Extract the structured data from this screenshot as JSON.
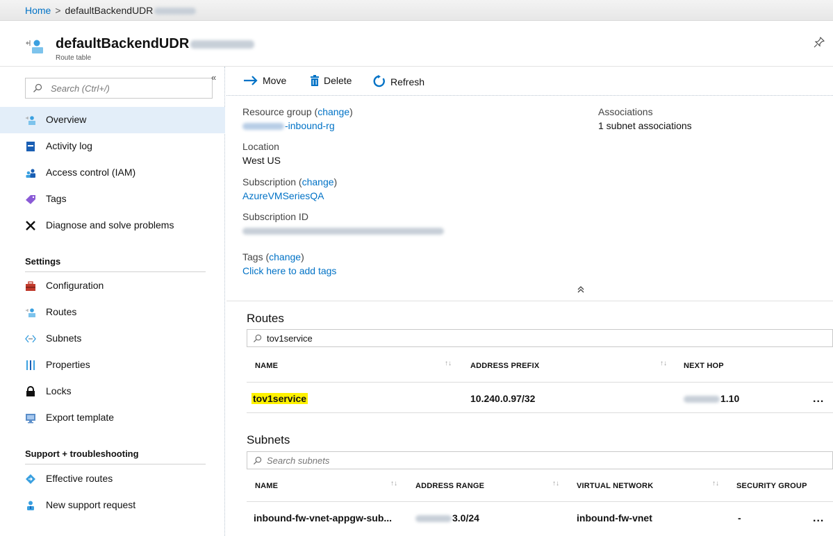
{
  "breadcrumb": {
    "home": "Home",
    "separator": ">",
    "current": "defaultBackendUDR"
  },
  "header": {
    "title": "defaultBackendUDR",
    "subtitle": "Route table",
    "icon": "route-table-icon",
    "pin_icon": "pin-icon"
  },
  "sidebar": {
    "search_placeholder": "Search (Ctrl+/)",
    "collapse": "«",
    "items": [
      {
        "label": "Overview",
        "icon": "route-table-icon",
        "active": true
      },
      {
        "label": "Activity log",
        "icon": "activity-log-icon"
      },
      {
        "label": "Access control (IAM)",
        "icon": "users-icon"
      },
      {
        "label": "Tags",
        "icon": "tag-icon"
      },
      {
        "label": "Diagnose and solve problems",
        "icon": "wrench-icon"
      }
    ],
    "settings_title": "Settings",
    "settings_items": [
      {
        "label": "Configuration",
        "icon": "toolbox-icon"
      },
      {
        "label": "Routes",
        "icon": "route-table-icon"
      },
      {
        "label": "Subnets",
        "icon": "subnet-icon"
      },
      {
        "label": "Properties",
        "icon": "properties-icon"
      },
      {
        "label": "Locks",
        "icon": "lock-icon"
      },
      {
        "label": "Export template",
        "icon": "export-icon"
      }
    ],
    "support_title": "Support + troubleshooting",
    "support_items": [
      {
        "label": "Effective routes",
        "icon": "effective-routes-icon"
      },
      {
        "label": "New support request",
        "icon": "support-person-icon"
      }
    ]
  },
  "toolbar": {
    "move": "Move",
    "delete": "Delete",
    "refresh": "Refresh"
  },
  "essentials": {
    "resource_group_label": "Resource group",
    "change": "change",
    "resource_group_value": "-inbound-rg",
    "location_label": "Location",
    "location_value": "West US",
    "subscription_label": "Subscription",
    "subscription_value": "AzureVMSeriesQA",
    "subscription_id_label": "Subscription ID",
    "tags_label": "Tags",
    "tags_link": "Click here to add tags",
    "associations_label": "Associations",
    "associations_value": "1 subnet associations",
    "collapse_chevron": "≈"
  },
  "routes": {
    "title": "Routes",
    "filter_value": "tov1service",
    "columns": [
      "NAME",
      "ADDRESS PREFIX",
      "NEXT HOP"
    ],
    "rows": [
      {
        "name": "tov1service",
        "address_prefix": "10.240.0.97/32",
        "next_hop": "1.10",
        "more": "..."
      }
    ]
  },
  "subnets": {
    "title": "Subnets",
    "filter_placeholder": "Search subnets",
    "columns": [
      "NAME",
      "ADDRESS RANGE",
      "VIRTUAL NETWORK",
      "SECURITY GROUP"
    ],
    "rows": [
      {
        "name": "inbound-fw-vnet-appgw-sub...",
        "address_range": "3.0/24",
        "virtual_network": "inbound-fw-vnet",
        "security_group": "-",
        "more": "..."
      }
    ]
  },
  "colors": {
    "link": "#0072c6",
    "active_nav": "#e3eef9",
    "highlight": "#fff200"
  }
}
